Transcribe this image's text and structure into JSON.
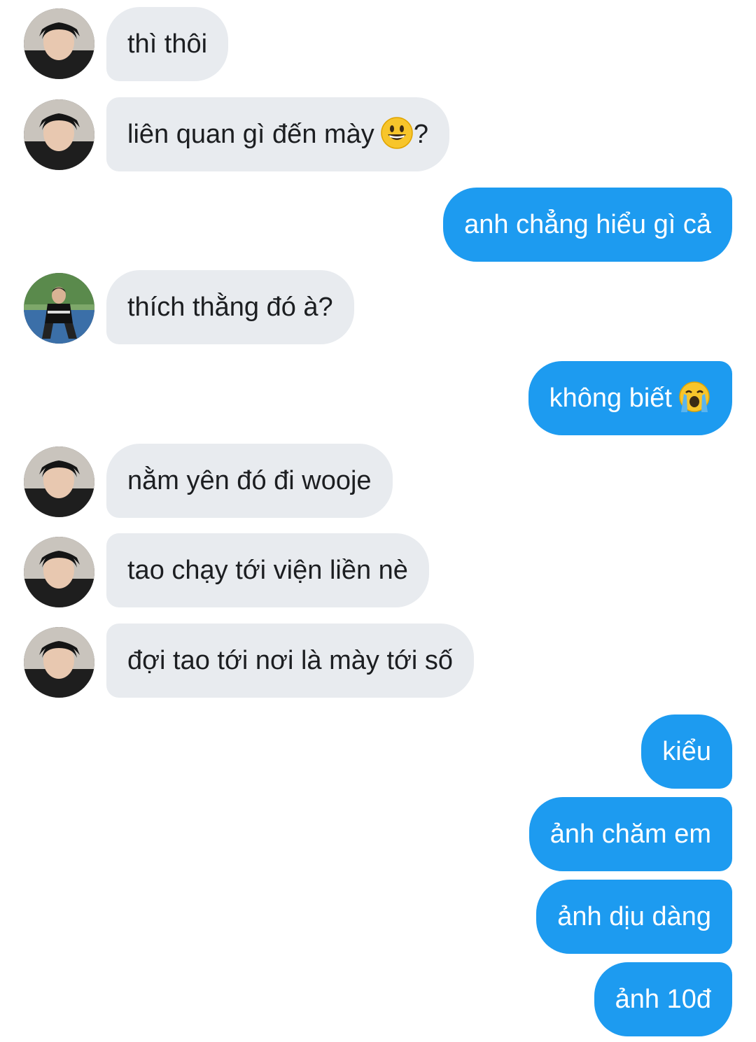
{
  "messages": [
    {
      "side": "in",
      "text": "thì thôi",
      "avatar": "boy-avatar-icon"
    },
    {
      "side": "in",
      "text": "liên quan gì đến mày",
      "emoji": "grinning-face-icon",
      "suffix": "?",
      "avatar": "boy-avatar-icon"
    },
    {
      "side": "out",
      "text": "anh chẳng hiểu gì cả"
    },
    {
      "side": "in",
      "text": "thích thằng đó à?",
      "avatar": "outdoor-avatar-icon"
    },
    {
      "side": "out",
      "text": "không biết",
      "emoji": "loudly-crying-face-icon"
    },
    {
      "side": "in",
      "text": "nằm yên đó đi wooje",
      "avatar": "boy-avatar-icon"
    },
    {
      "side": "in",
      "text": "tao chạy tới viện liền nè",
      "avatar": "boy-avatar-icon"
    },
    {
      "side": "in",
      "text": "đợi tao tới nơi là mày tới số",
      "avatar": "boy-avatar-icon"
    },
    {
      "side": "out",
      "text": "kiểu"
    },
    {
      "side": "out",
      "text": "ảnh chăm em"
    },
    {
      "side": "out",
      "text": "ảnh dịu dàng"
    },
    {
      "side": "out",
      "text": "ảnh 10đ"
    }
  ],
  "colors": {
    "incoming_bubble": "#e8ebef",
    "outgoing_bubble": "#1d9bf0",
    "incoming_text": "#1c1e21",
    "outgoing_text": "#ffffff"
  }
}
